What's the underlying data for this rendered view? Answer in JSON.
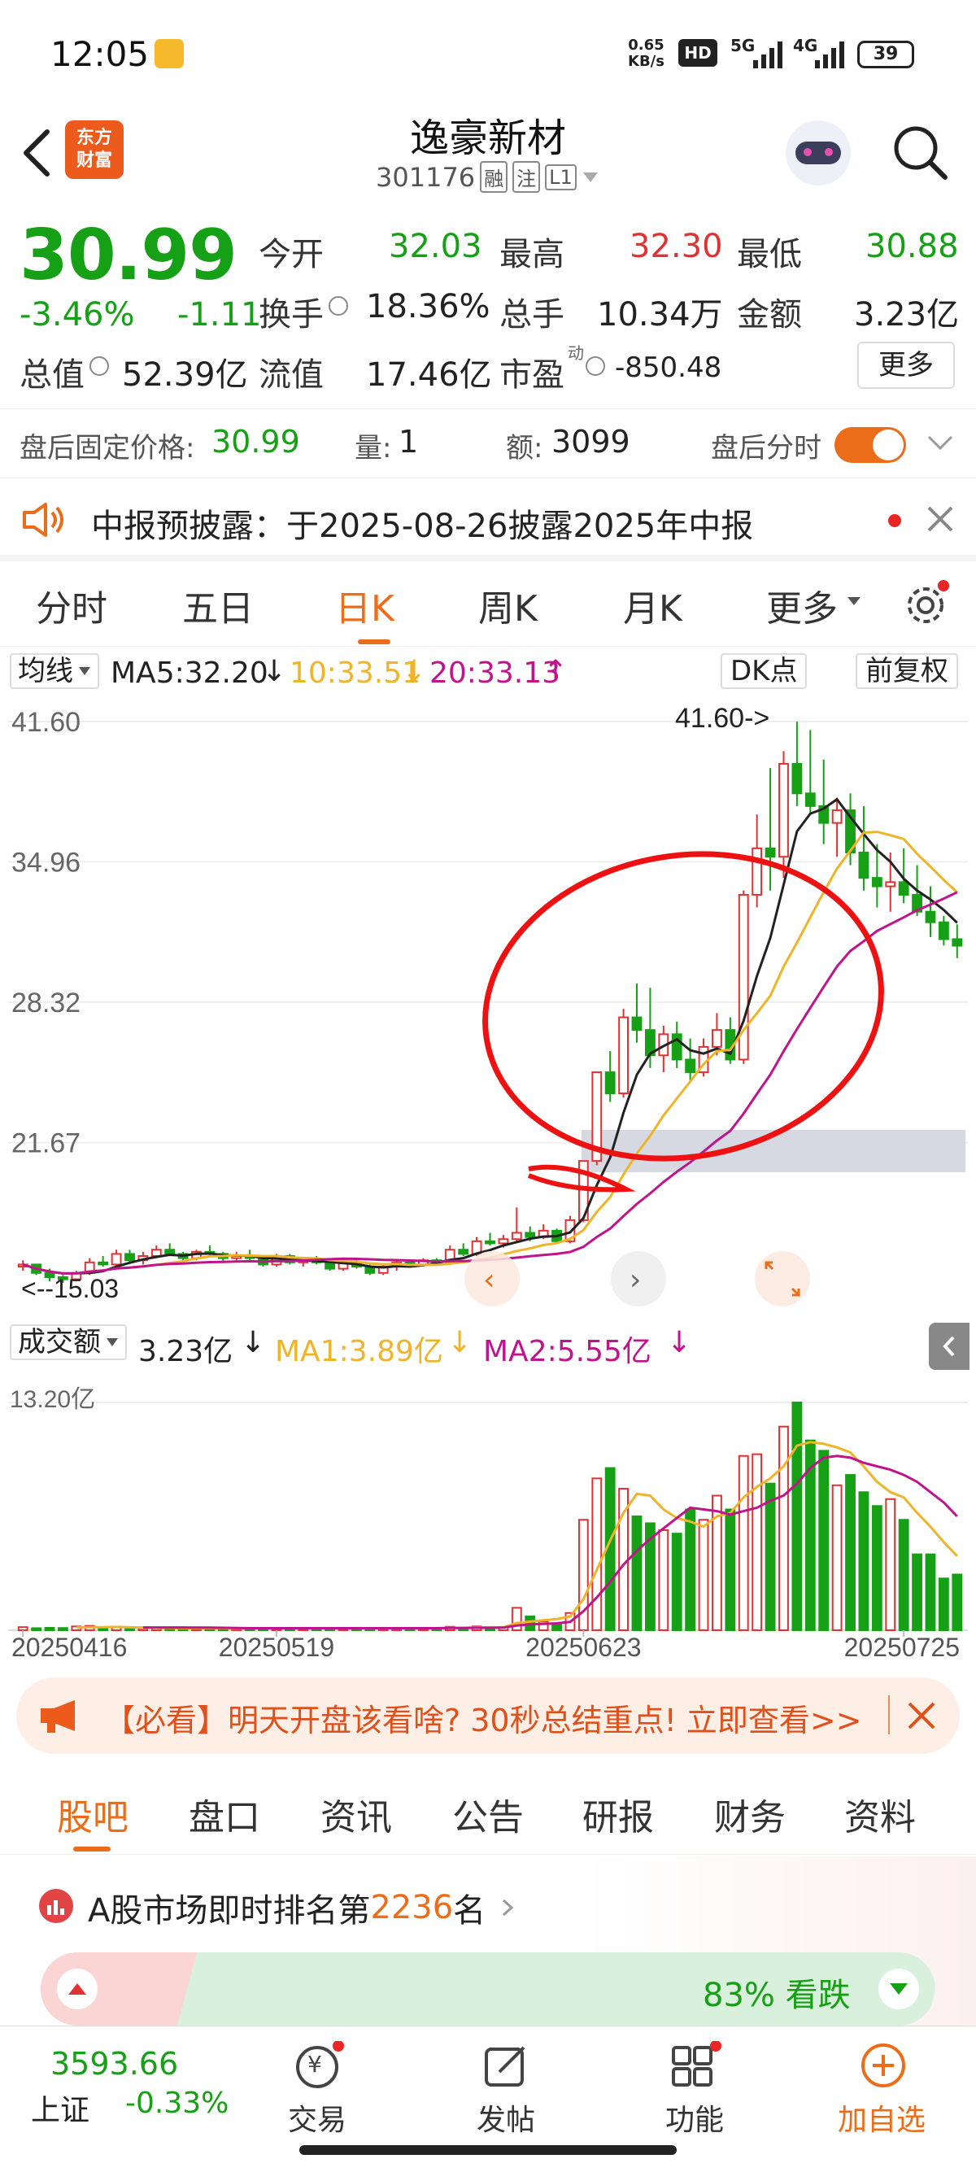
{
  "status_bar": {
    "time": "12:05",
    "net_speed_top": "0.65",
    "net_speed_bottom": "KB/s",
    "hd": "HD",
    "sig1": "5G",
    "sig2": "4G",
    "battery": "39"
  },
  "header": {
    "logo_line1": "东方",
    "logo_line2": "财富",
    "title": "逸豪新材",
    "code": "301176",
    "badges": [
      "融",
      "注",
      "L1"
    ]
  },
  "quote": {
    "price": "30.99",
    "change_pct": "-3.46%",
    "change": "-1.11",
    "fields": [
      {
        "label": "今开",
        "value": "32.03",
        "color": "green"
      },
      {
        "label": "最高",
        "value": "32.30",
        "color": "red"
      },
      {
        "label": "最低",
        "value": "30.88",
        "color": "green"
      },
      {
        "label": "换手",
        "value": "18.36%",
        "color": "black"
      },
      {
        "label": "总手",
        "value": "10.34万",
        "color": "black"
      },
      {
        "label": "金额",
        "value": "3.23亿",
        "color": "black"
      },
      {
        "label": "总值",
        "value": "52.39亿",
        "color": "black"
      },
      {
        "label": "流值",
        "value": "17.46亿",
        "color": "black"
      },
      {
        "label": "市盈",
        "value": "-850.48",
        "color": "black"
      }
    ],
    "pe_superscript": "动",
    "more_label": "更多"
  },
  "after_hours": {
    "price_label": "盘后固定价格:",
    "price": "30.99",
    "vol_label": "量:",
    "vol": "1",
    "amt_label": "额:",
    "amt": "3099",
    "toggle_label": "盘后分时"
  },
  "notice": {
    "text": "中报预披露：于2025-08-26披露2025年中报"
  },
  "chart_tabs": [
    "分时",
    "五日",
    "日K",
    "周K",
    "月K",
    "更多"
  ],
  "indicators": {
    "type_label": "均线",
    "ma5": "MA5:32.20",
    "ma10": "10:33.51",
    "ma20": "20:33.13",
    "dk": "DK点",
    "adjust": "前复权"
  },
  "volume_indicators": {
    "type_label": "成交额",
    "value": "3.23亿",
    "ma1": "MA1:3.89亿",
    "ma2": "MA2:5.55亿"
  },
  "colors": {
    "up": "#e03232",
    "down": "#16a016",
    "accent": "#ec6d19",
    "ma5": "#222222",
    "ma10": "#f0b429",
    "ma20": "#c0148c"
  },
  "chart_data": {
    "type": "candlestick",
    "price_axis_ticks": [
      "41.60",
      "34.96",
      "28.32",
      "21.67"
    ],
    "ylim": [
      15.03,
      41.6
    ],
    "annotations": {
      "max_label": "41.60->",
      "min_label": "<--15.03"
    },
    "volume_axis_tick": "13.20亿",
    "date_ticks": [
      "20250416",
      "20250519",
      "20250623",
      "20250725"
    ],
    "candles": [
      [
        15.8,
        16.1,
        15.6,
        15.9
      ],
      [
        15.9,
        15.9,
        15.4,
        15.5
      ],
      [
        15.5,
        15.7,
        15.1,
        15.3
      ],
      [
        15.3,
        15.4,
        15.03,
        15.2
      ],
      [
        15.2,
        15.6,
        15.1,
        15.5
      ],
      [
        15.5,
        16.2,
        15.4,
        16.0
      ],
      [
        16.0,
        16.3,
        15.8,
        15.9
      ],
      [
        15.9,
        16.6,
        15.8,
        16.4
      ],
      [
        16.4,
        16.6,
        16.0,
        16.1
      ],
      [
        16.1,
        16.5,
        15.9,
        16.3
      ],
      [
        16.3,
        16.8,
        16.2,
        16.6
      ],
      [
        16.6,
        16.9,
        16.3,
        16.4
      ],
      [
        16.4,
        16.5,
        16.0,
        16.2
      ],
      [
        16.2,
        16.6,
        16.1,
        16.5
      ],
      [
        16.5,
        16.8,
        16.3,
        16.4
      ],
      [
        16.4,
        16.5,
        16.0,
        16.2
      ],
      [
        16.2,
        16.5,
        16.0,
        16.3
      ],
      [
        16.3,
        16.6,
        16.1,
        16.2
      ],
      [
        16.2,
        16.3,
        15.8,
        15.9
      ],
      [
        15.9,
        16.4,
        15.8,
        16.3
      ],
      [
        16.3,
        16.4,
        15.9,
        16.0
      ],
      [
        16.0,
        16.2,
        15.8,
        16.1
      ],
      [
        16.1,
        16.3,
        15.9,
        16.0
      ],
      [
        16.0,
        16.1,
        15.6,
        15.7
      ],
      [
        15.7,
        16.1,
        15.6,
        16.0
      ],
      [
        16.0,
        16.2,
        15.7,
        15.8
      ],
      [
        15.8,
        16.0,
        15.4,
        15.5
      ],
      [
        15.5,
        15.9,
        15.4,
        15.8
      ],
      [
        15.8,
        16.1,
        15.6,
        16.0
      ],
      [
        16.0,
        16.1,
        15.8,
        15.9
      ],
      [
        15.9,
        16.2,
        15.8,
        16.1
      ],
      [
        16.1,
        16.2,
        15.9,
        16.0
      ],
      [
        16.0,
        16.8,
        15.9,
        16.6
      ],
      [
        16.6,
        16.9,
        16.3,
        16.4
      ],
      [
        16.4,
        17.2,
        16.3,
        17.0
      ],
      [
        17.0,
        17.4,
        16.8,
        16.9
      ],
      [
        16.9,
        17.3,
        16.7,
        17.1
      ],
      [
        17.1,
        18.6,
        17.0,
        17.4
      ],
      [
        17.4,
        17.7,
        17.0,
        17.2
      ],
      [
        17.2,
        17.8,
        17.1,
        17.5
      ],
      [
        17.5,
        17.6,
        16.9,
        17.0
      ],
      [
        17.0,
        18.2,
        16.9,
        18.0
      ],
      [
        18.0,
        20.8,
        17.9,
        20.8
      ],
      [
        20.8,
        25.0,
        20.6,
        25.0
      ],
      [
        25.0,
        26.0,
        23.6,
        24.0
      ],
      [
        24.0,
        28.0,
        23.8,
        27.6
      ],
      [
        27.6,
        29.2,
        26.4,
        27.0
      ],
      [
        27.0,
        29.0,
        25.2,
        25.8
      ],
      [
        25.8,
        27.2,
        25.0,
        26.8
      ],
      [
        26.8,
        27.4,
        25.2,
        25.6
      ],
      [
        25.6,
        26.6,
        24.6,
        25.0
      ],
      [
        25.0,
        26.6,
        24.8,
        26.2
      ],
      [
        26.2,
        27.8,
        25.8,
        27.0
      ],
      [
        27.0,
        27.6,
        25.4,
        25.6
      ],
      [
        25.6,
        33.6,
        25.4,
        33.4
      ],
      [
        33.4,
        37.2,
        32.8,
        35.6
      ],
      [
        35.6,
        39.4,
        33.6,
        35.2
      ],
      [
        35.2,
        40.2,
        34.2,
        39.6
      ],
      [
        39.6,
        41.6,
        37.6,
        38.2
      ],
      [
        38.2,
        41.2,
        37.2,
        37.6
      ],
      [
        37.6,
        39.8,
        35.8,
        36.8
      ],
      [
        36.8,
        38.0,
        35.2,
        37.4
      ],
      [
        37.4,
        38.2,
        34.8,
        35.4
      ],
      [
        35.4,
        37.6,
        33.6,
        34.2
      ],
      [
        34.2,
        35.8,
        32.8,
        33.8
      ],
      [
        33.8,
        35.4,
        32.6,
        34.0
      ],
      [
        34.0,
        35.6,
        33.0,
        33.4
      ],
      [
        33.4,
        34.8,
        32.4,
        32.6
      ],
      [
        32.6,
        33.8,
        31.4,
        32.1
      ],
      [
        32.1,
        32.4,
        31.0,
        31.3
      ],
      [
        31.3,
        32.0,
        30.4,
        30.99
      ]
    ],
    "volume": [
      0.18,
      0.12,
      0.14,
      0.13,
      0.22,
      0.25,
      0.15,
      0.21,
      0.12,
      0.11,
      0.14,
      0.12,
      0.11,
      0.13,
      0.1,
      0.12,
      0.1,
      0.14,
      0.12,
      0.13,
      0.11,
      0.12,
      0.1,
      0.14,
      0.11,
      0.12,
      0.13,
      0.1,
      0.11,
      0.12,
      0.14,
      0.1,
      0.2,
      0.16,
      0.22,
      0.14,
      0.18,
      1.3,
      0.8,
      0.5,
      0.4,
      1.0,
      6.4,
      8.8,
      9.4,
      8.2,
      6.6,
      6.2,
      5.8,
      5.6,
      7.0,
      6.4,
      7.8,
      7.0,
      10.1,
      10.2,
      8.5,
      11.8,
      13.2,
      11.0,
      10.4,
      8.4,
      9.0,
      8.0,
      7.2,
      7.6,
      6.4,
      4.4,
      4.4,
      3.0,
      3.23
    ],
    "ma_volume": {
      "MA1": [
        null,
        null,
        null,
        null,
        0.16,
        0.17,
        0.18,
        0.19,
        0.17,
        0.16,
        0.14,
        0.13,
        0.12,
        0.12,
        0.12,
        0.12,
        0.11,
        0.12,
        0.12,
        0.12,
        0.12,
        0.12,
        0.12,
        0.12,
        0.12,
        0.12,
        0.12,
        0.12,
        0.12,
        0.12,
        0.12,
        0.12,
        0.14,
        0.14,
        0.16,
        0.17,
        0.17,
        0.42,
        0.5,
        0.58,
        0.64,
        0.8,
        1.8,
        3.5,
        5.2,
        6.8,
        7.9,
        7.8,
        7.0,
        6.5,
        6.3,
        6.0,
        6.6,
        6.8,
        7.7,
        8.3,
        8.8,
        9.5,
        10.7,
        10.9,
        10.8,
        10.6,
        10.3,
        9.5,
        8.6,
        8.0,
        7.7,
        6.8,
        6.0,
        5.1,
        4.3
      ],
      "MA2": [
        null,
        null,
        null,
        null,
        null,
        null,
        null,
        null,
        null,
        0.16,
        0.16,
        0.16,
        0.16,
        0.15,
        0.15,
        0.14,
        0.13,
        0.12,
        0.12,
        0.12,
        0.12,
        0.12,
        0.12,
        0.12,
        0.12,
        0.12,
        0.12,
        0.12,
        0.12,
        0.12,
        0.12,
        0.12,
        0.13,
        0.13,
        0.14,
        0.14,
        0.15,
        0.27,
        0.34,
        0.37,
        0.4,
        0.48,
        1.1,
        1.9,
        2.8,
        3.8,
        4.6,
        5.3,
        5.9,
        6.5,
        7.1,
        7.0,
        6.9,
        6.7,
        6.9,
        7.1,
        7.5,
        7.8,
        8.5,
        9.4,
        10.0,
        10.1,
        10.0,
        9.7,
        9.5,
        9.3,
        9.0,
        8.6,
        8.0,
        7.4,
        6.6
      ]
    }
  },
  "banner": {
    "text": "【必看】明天开盘该看啥? 30秒总结重点! 立即查看>>"
  },
  "bottom_tabs": [
    "股吧",
    "盘口",
    "资讯",
    "公告",
    "研报",
    "财务",
    "资料"
  ],
  "ranking": {
    "prefix": "A股市场即时排名第",
    "rank": "2236",
    "suffix": "名"
  },
  "sentiment": {
    "text": "83% 看跌",
    "bear_pct": 0.83
  },
  "bottom_nav": {
    "index_value": "3593.66",
    "index_name": "上证",
    "index_change": "-0.33%",
    "items": [
      "交易",
      "发帖",
      "功能",
      "加自选"
    ],
    "trade_symbol": "¥"
  }
}
